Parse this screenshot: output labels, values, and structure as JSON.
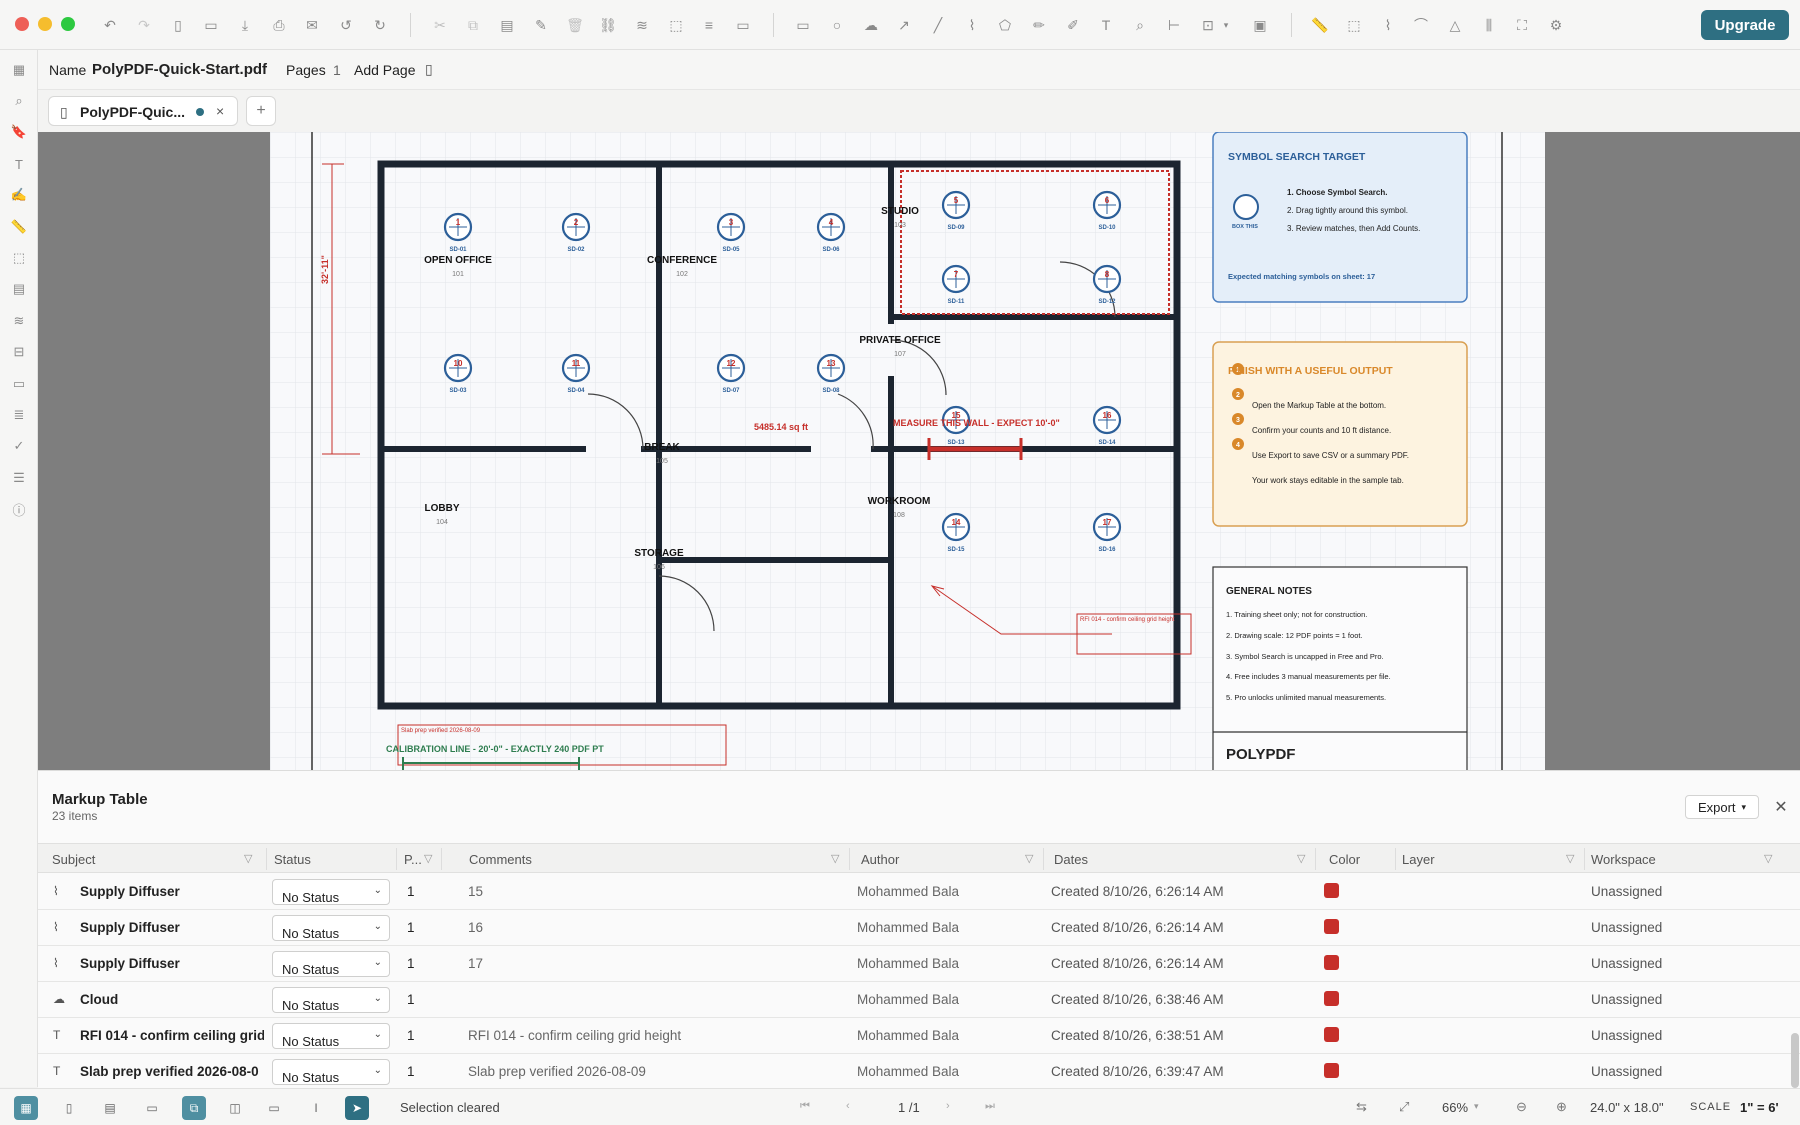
{
  "app": {
    "upgrade_label": "Upgrade"
  },
  "docbar": {
    "name_label": "Name",
    "file_name": "PolyPDF-Quick-Start.pdf",
    "pages_label": "Pages",
    "pages_count": "1",
    "add_page_label": "Add Page"
  },
  "tabs": {
    "active_label": "PolyPDF-Quic...",
    "add_label": "+"
  },
  "sheet": {
    "rooms": [
      {
        "name": "OPEN OFFICE",
        "number": "101"
      },
      {
        "name": "CONFERENCE",
        "number": "102"
      },
      {
        "name": "STUDIO",
        "number": "103"
      },
      {
        "name": "LOBBY",
        "number": "104"
      },
      {
        "name": "BREAK",
        "number": "105"
      },
      {
        "name": "STORAGE",
        "number": "106"
      },
      {
        "name": "PRIVATE OFFICE",
        "number": "107"
      },
      {
        "name": "WORKROOM",
        "number": "108"
      }
    ],
    "symbols": [
      "SD-01",
      "SD-02",
      "SD-05",
      "SD-06",
      "SD-09",
      "SD-10",
      "SD-11",
      "SD-12",
      "SD-03",
      "SD-04",
      "SD-07",
      "SD-08",
      "SD-13",
      "SD-14",
      "SD-15",
      "SD-16"
    ],
    "symbol_numbers": [
      "1",
      "2",
      "3",
      "4",
      "5",
      "6",
      "7",
      "8",
      "10",
      "11",
      "12",
      "13",
      "15",
      "16",
      "14",
      "17"
    ],
    "dimension_label": "32'-11\"",
    "area_label": "5485.14 sq ft",
    "measure_label": "MEASURE THIS WALL - EXPECT 10'-0\"",
    "rfi_note": "RFI 014 - confirm ceiling grid height",
    "slab_note": "Slab prep verified 2026-08-09",
    "calibration_label": "CALIBRATION LINE - 20'-0\" - EXACTLY 240 PDF PT",
    "symbol_search": {
      "title": "SYMBOL SEARCH TARGET",
      "box_label": "BOX THIS",
      "steps": [
        "1. Choose Symbol Search.",
        "2. Drag tightly around this symbol.",
        "3. Review matches, then Add Counts."
      ],
      "expected": "Expected matching symbols on sheet: 17"
    },
    "finish": {
      "title": "FINISH WITH A USEFUL OUTPUT",
      "steps": [
        "Open the Markup Table at the bottom.",
        "Confirm your counts and 10 ft distance.",
        "Use Export to save CSV or a summary PDF.",
        "Your work stays editable in the sample tab."
      ],
      "nums": [
        "1",
        "2",
        "3",
        "4"
      ]
    },
    "notes": {
      "title": "GENERAL NOTES",
      "items": [
        "1. Training sheet only; not for construction.",
        "2. Drawing scale: 12 PDF points = 1 foot.",
        "3. Symbol Search is uncapped in Free and Pro.",
        "4. Free includes 3 manual measurements per file.",
        "5. Pro unlocks unlimited manual measurements."
      ]
    },
    "brand": "POLYPDF"
  },
  "markup_table": {
    "title": "Markup Table",
    "count": "23 items",
    "export_label": "Export",
    "headers": {
      "subject": "Subject",
      "status": "Status",
      "page": "P...",
      "comments": "Comments",
      "author": "Author",
      "dates": "Dates",
      "color": "Color",
      "layer": "Layer",
      "workspace": "Workspace"
    },
    "rows": [
      {
        "subject": "Supply Diffuser",
        "status": "No Status",
        "page": "1",
        "comments": "15",
        "author": "Mohammed Bala",
        "date": "Created 8/10/26, 6:26:14 AM",
        "workspace": "Unassigned",
        "icon": "polyline-icon"
      },
      {
        "subject": "Supply Diffuser",
        "status": "No Status",
        "page": "1",
        "comments": "16",
        "author": "Mohammed Bala",
        "date": "Created 8/10/26, 6:26:14 AM",
        "workspace": "Unassigned",
        "icon": "polyline-icon"
      },
      {
        "subject": "Supply Diffuser",
        "status": "No Status",
        "page": "1",
        "comments": "17",
        "author": "Mohammed Bala",
        "date": "Created 8/10/26, 6:26:14 AM",
        "workspace": "Unassigned",
        "icon": "polyline-icon"
      },
      {
        "subject": "Cloud",
        "status": "No Status",
        "page": "1",
        "comments": "",
        "author": "Mohammed Bala",
        "date": "Created 8/10/26, 6:38:46 AM",
        "workspace": "Unassigned",
        "icon": "cloud-icon"
      },
      {
        "subject": "RFI 014 - confirm ceiling grid",
        "status": "No Status",
        "page": "1",
        "comments": "RFI 014 - confirm ceiling grid height",
        "author": "Mohammed Bala",
        "date": "Created 8/10/26, 6:38:51 AM",
        "workspace": "Unassigned",
        "icon": "text-icon"
      },
      {
        "subject": "Slab prep verified 2026-08-0",
        "status": "No Status",
        "page": "1",
        "comments": "Slab prep verified 2026-08-09",
        "author": "Mohammed Bala",
        "date": "Created 8/10/26, 6:39:47 AM",
        "workspace": "Unassigned",
        "icon": "text-icon"
      }
    ]
  },
  "statusbar": {
    "message": "Selection cleared",
    "page_indicator": "1 /1",
    "zoom": "66%",
    "page_size": "24.0\" x 18.0\"",
    "scale_label": "SCALE",
    "scale_value": "1\" = 6'"
  },
  "colors": {
    "accent": "#2e6f82",
    "markup_red": "#c62f2a",
    "symbol_blue": "#2c5f99",
    "finish_orange": "#d9882a"
  }
}
